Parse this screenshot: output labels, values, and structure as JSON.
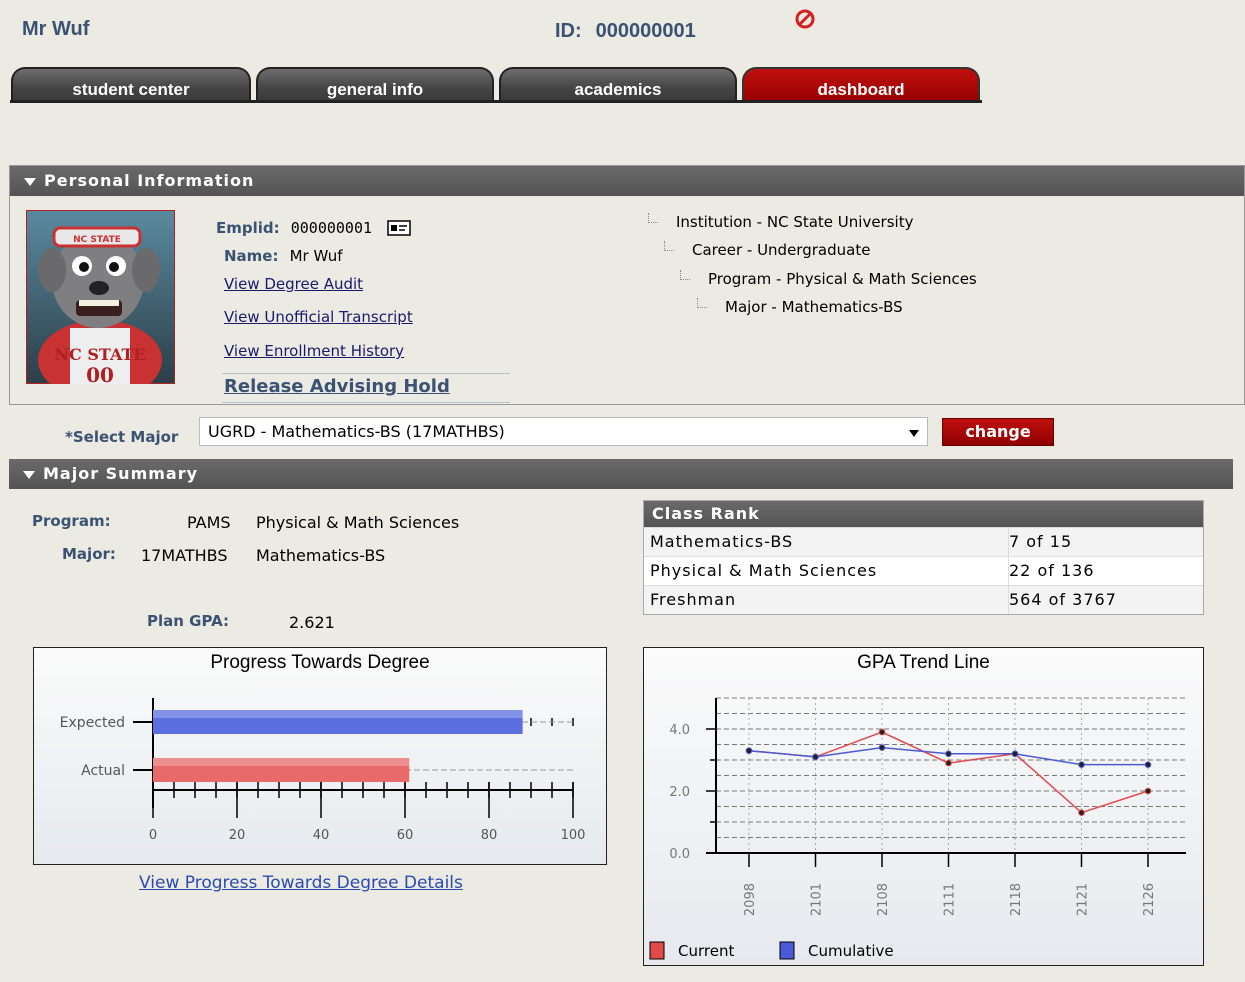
{
  "header": {
    "name": "Mr Wuf",
    "id_label": "ID:",
    "id_value": "000000001"
  },
  "tabs": [
    {
      "label": "student center"
    },
    {
      "label": "general info"
    },
    {
      "label": "academics"
    },
    {
      "label": "dashboard",
      "active": true
    }
  ],
  "personal": {
    "section_title": "Personal Information",
    "emplid_label": "Emplid:",
    "emplid_value": "000000001",
    "name_label": "Name:",
    "name_value": "Mr Wuf",
    "links": {
      "degree_audit": "View Degree Audit",
      "transcript": "View Unofficial Transcript",
      "enrollment": "View Enrollment History",
      "release_hold": "Release Advising Hold"
    },
    "tree": [
      "Institution - NC State University",
      "Career - Undergraduate",
      "Program - Physical & Math Sciences",
      "Major - Mathematics-BS"
    ]
  },
  "select_major": {
    "label": "*Select Major",
    "value": "UGRD - Mathematics-BS (17MATHBS)",
    "button": "change"
  },
  "major_summary": {
    "section_title": "Major Summary",
    "program_label": "Program:",
    "program_code": "PAMS",
    "program_name": "Physical & Math Sciences",
    "major_label": "Major:",
    "major_code": "17MATHBS",
    "major_name": "Mathematics-BS",
    "gpa_label": "Plan GPA:",
    "gpa_value": "2.621"
  },
  "class_rank": {
    "title": "Class Rank",
    "rows": [
      {
        "label": "Mathematics-BS",
        "value": "7 of 15"
      },
      {
        "label": "Physical & Math Sciences",
        "value": "22 of 136"
      },
      {
        "label": "Freshman",
        "value": "564 of 3767"
      }
    ]
  },
  "progress_link": "View Progress Towards Degree Details",
  "colors": {
    "current": "#e04a4a",
    "cumulative": "#4a5ad8",
    "expected_bar": "#5a6ee0",
    "actual_bar": "#e86a6a"
  },
  "chart_data": [
    {
      "type": "bar",
      "orientation": "horizontal",
      "title": "Progress Towards Degree",
      "categories": [
        "Expected",
        "Actual"
      ],
      "values": [
        88,
        61
      ],
      "xlim": [
        0,
        100
      ],
      "xticks": [
        0,
        20,
        40,
        60,
        80,
        100
      ]
    },
    {
      "type": "line",
      "title": "GPA Trend Line",
      "x": [
        "2098",
        "2101",
        "2108",
        "2111",
        "2118",
        "2121",
        "2126"
      ],
      "series": [
        {
          "name": "Current",
          "values": [
            3.3,
            3.1,
            3.9,
            2.9,
            3.2,
            1.3,
            2.0
          ]
        },
        {
          "name": "Cumulative",
          "values": [
            3.3,
            3.1,
            3.4,
            3.2,
            3.2,
            2.85,
            2.85
          ]
        }
      ],
      "ylim": [
        0,
        5
      ],
      "yticks": [
        "0.0",
        "2.0",
        "4.0"
      ],
      "legend": "bottom-left",
      "grid": true
    }
  ]
}
